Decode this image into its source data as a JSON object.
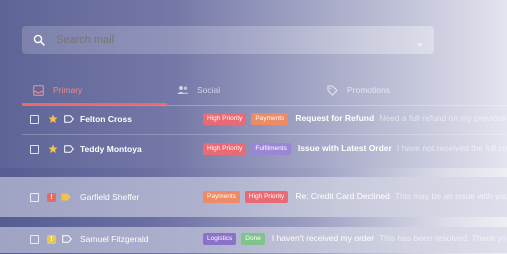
{
  "search": {
    "placeholder": "Search mail"
  },
  "tabs": [
    {
      "label": "Primary"
    },
    {
      "label": "Social"
    },
    {
      "label": "Promotions"
    }
  ],
  "emails": [
    {
      "sender": "Felton Cross",
      "badges": [
        "High Priority",
        "Payments"
      ],
      "subject": "Request for Refund",
      "preview": "Need a full refund on my previous order"
    },
    {
      "sender": "Teddy Montoya",
      "badges": [
        "High Priority",
        "Fulfilments"
      ],
      "subject": "Issue with Latest Order",
      "preview": "I have not received the full consignment"
    },
    {
      "sender": "Garfield Sheffer",
      "badges": [
        "Payments",
        "High Priority"
      ],
      "subject": "Re: Credit Card Declined",
      "preview": "This may be an issue with your Credit Card"
    },
    {
      "sender": "Samuel Fitzgerald",
      "badges": [
        "Logistics",
        "Done"
      ],
      "subject": "I haven't received my order",
      "preview": "This has been resolved. Thank you!"
    }
  ],
  "colors": {
    "accent": "#e96a6a",
    "high_priority": "#e96a74",
    "payments": "#ee8a64",
    "fulfilments": "#9b86d6",
    "logistics": "#8a72c8",
    "done": "#7fc48a",
    "star": "#f3c246"
  },
  "icons": [
    "search-icon",
    "chevron-down-icon",
    "inbox-icon",
    "people-icon",
    "tag-icon",
    "star-icon",
    "label-icon",
    "important-icon"
  ]
}
